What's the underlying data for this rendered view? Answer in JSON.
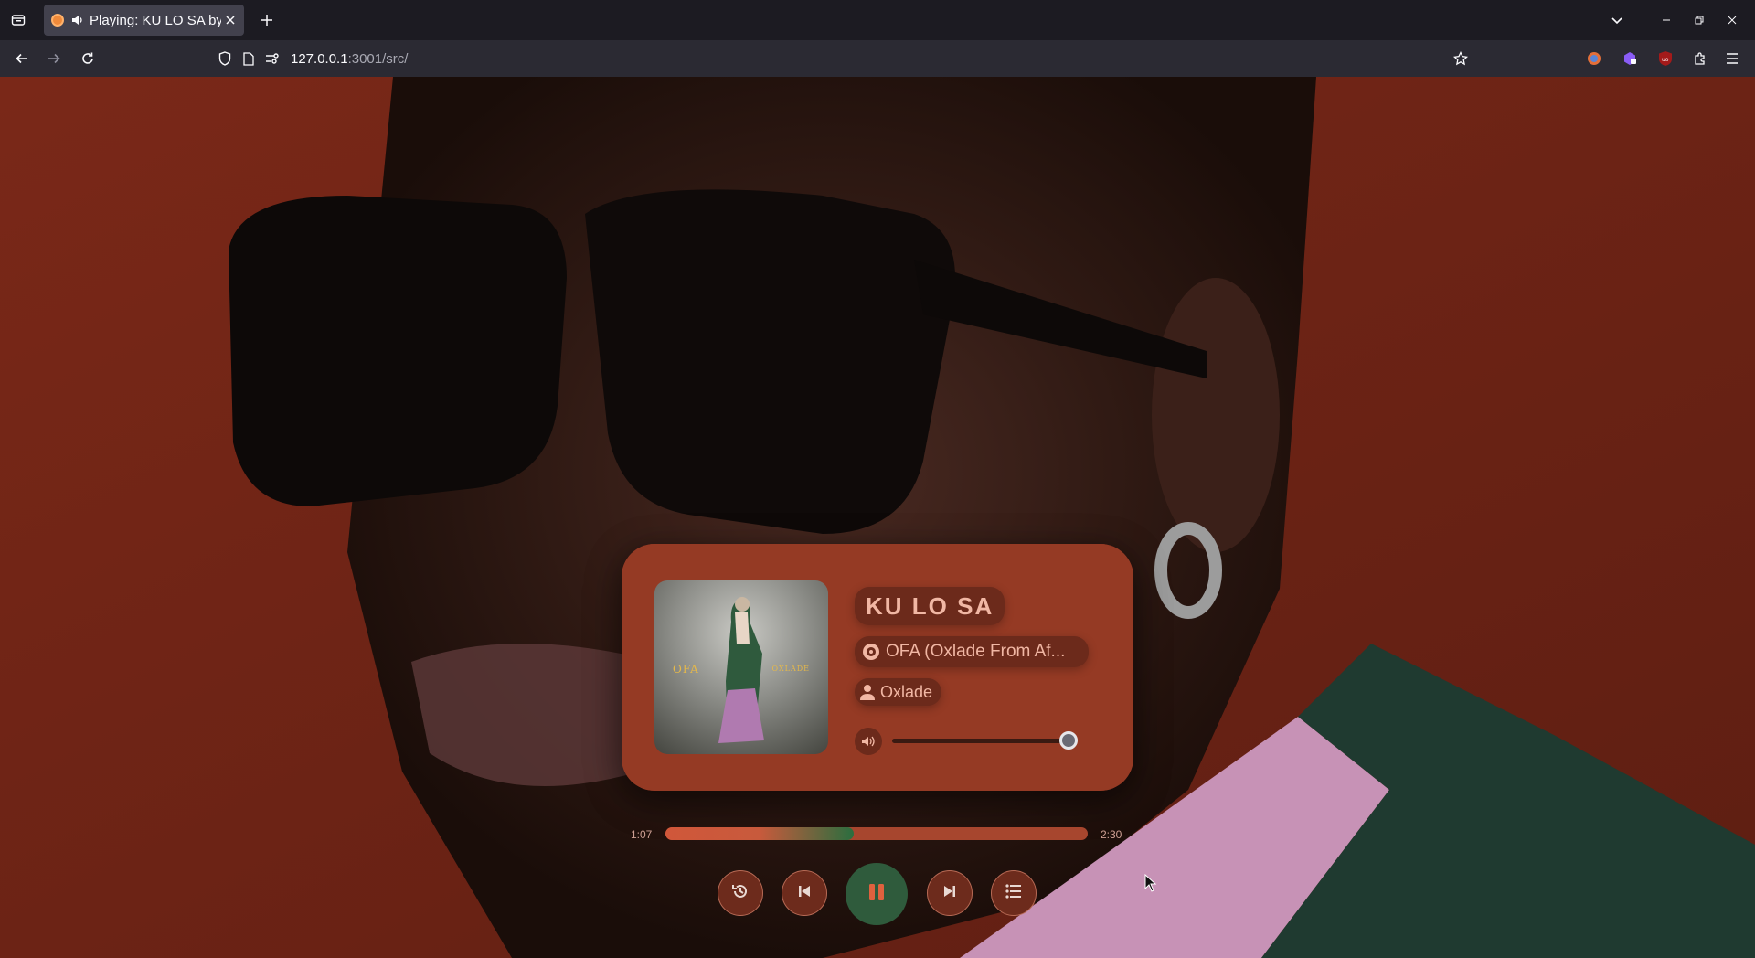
{
  "browser": {
    "tab": {
      "title": "Playing: KU LO SA by Oxlade"
    },
    "url": {
      "host": "127.0.0.1",
      "path": ":3001/src/"
    }
  },
  "player": {
    "track": {
      "title": "KU LO SA",
      "album": "OFA (Oxlade From Af...",
      "artist": "Oxlade"
    },
    "cover": {
      "left_text": "OFA",
      "right_text": "OXLADE"
    },
    "volume": {
      "level": 1.0
    },
    "progress": {
      "current": "1:07",
      "total": "2:30",
      "fraction": 0.445
    },
    "colors": {
      "accent": "#6c2a1b",
      "card": "#953a24",
      "play": "#2f5b3c"
    }
  },
  "icons": {
    "history": "history-icon",
    "previous": "skip-back-icon",
    "play_pause": "pause-icon",
    "next": "skip-forward-icon",
    "queue": "queue-list-icon"
  }
}
